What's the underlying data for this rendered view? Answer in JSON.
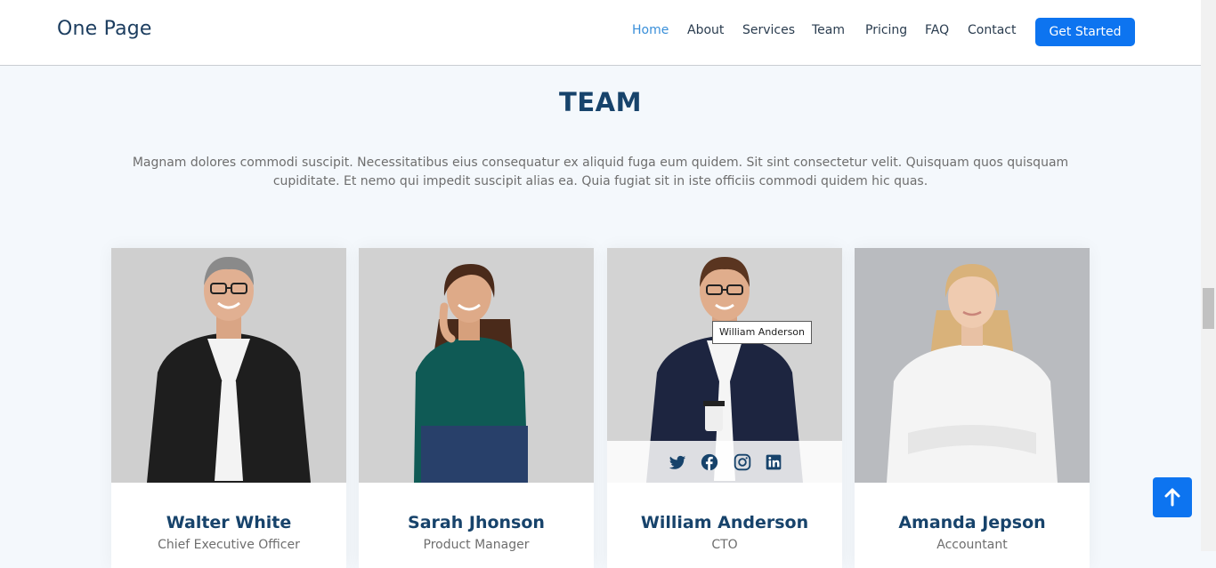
{
  "header": {
    "logo": "One Page",
    "nav": [
      {
        "label": "Home",
        "active": true
      },
      {
        "label": "About",
        "active": false
      },
      {
        "label": "Services",
        "active": false
      },
      {
        "label": "Team",
        "active": false
      },
      {
        "label": "Pricing",
        "active": false
      },
      {
        "label": "FAQ",
        "active": false
      },
      {
        "label": "Contact",
        "active": false
      }
    ],
    "cta": "Get Started"
  },
  "section": {
    "title": "TEAM",
    "description": "Magnam dolores commodi suscipit. Necessitatibus eius consequatur ex aliquid fuga eum quidem. Sit sint consectetur velit. Quisquam quos quisquam cupiditate. Et nemo qui impedit suscipit alias ea. Quia fugiat sit in iste officiis commodi quidem hic quas."
  },
  "team": [
    {
      "name": "Walter White",
      "role": "Chief Executive Officer"
    },
    {
      "name": "Sarah Jhonson",
      "role": "Product Manager"
    },
    {
      "name": "William Anderson",
      "role": "CTO"
    },
    {
      "name": "Amanda Jepson",
      "role": "Accountant"
    }
  ],
  "social_icons": [
    "twitter-icon",
    "facebook-icon",
    "instagram-icon",
    "linkedin-icon"
  ],
  "tooltip": "William Anderson",
  "colors": {
    "accent": "#0d74f0",
    "heading": "#17436b",
    "nav_active": "#3a8fd9",
    "background": "#f4f8fc"
  }
}
